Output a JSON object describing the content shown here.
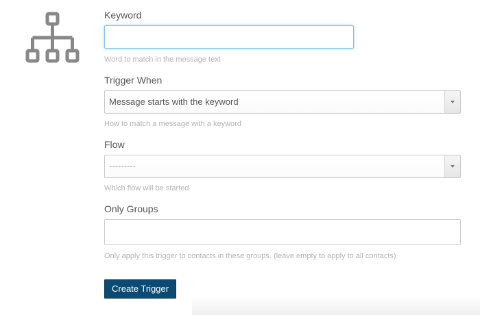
{
  "icon": {
    "name": "sitemap-icon",
    "color": "#888888"
  },
  "keyword": {
    "label": "Keyword",
    "value": "",
    "help": "Word to match in the message text"
  },
  "trigger_when": {
    "label": "Trigger When",
    "selected": "Message starts with the keyword",
    "help": "How to match a message with a keyword"
  },
  "flow": {
    "label": "Flow",
    "selected": "---------",
    "help": "Which flow will be started"
  },
  "only_groups": {
    "label": "Only Groups",
    "value": "",
    "help": "Only apply this trigger to contacts in these groups. (leave empty to apply to all contacts)"
  },
  "submit": {
    "label": "Create Trigger",
    "color": "#0b4b73"
  }
}
